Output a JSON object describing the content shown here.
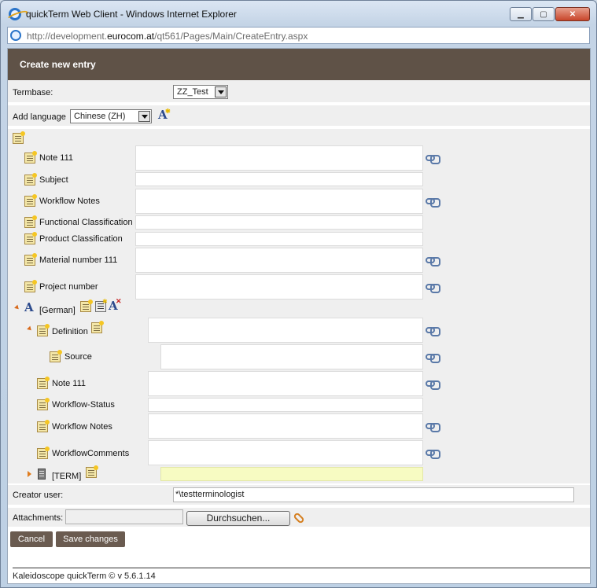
{
  "window": {
    "title": "quickTerm Web Client - Windows Internet Explorer",
    "url_prefix": "http://development.",
    "url_domain": "eurocom.at",
    "url_path": "/qt561/Pages/Main/CreateEntry.aspx",
    "buttons": {
      "minimize": "▁",
      "maximize": "▢",
      "close": "✕"
    }
  },
  "header": {
    "title": "Create new entry"
  },
  "termbase": {
    "label": "Termbase:",
    "value": "ZZ_Test"
  },
  "add_language": {
    "label": "Add language",
    "value": "Chinese (ZH)"
  },
  "entry_fields": [
    {
      "label": "Note 111"
    },
    {
      "label": "Subject"
    },
    {
      "label": "Workflow Notes"
    },
    {
      "label": "Functional Classification"
    },
    {
      "label": "Product Classification"
    },
    {
      "label": "Material number 111"
    },
    {
      "label": "Project number"
    }
  ],
  "language": {
    "label": "[German]"
  },
  "definition": {
    "label": "Definition"
  },
  "source": {
    "label": "Source"
  },
  "language_fields": [
    {
      "label": "Note 111"
    },
    {
      "label": "Workflow-Status"
    },
    {
      "label": "Workflow Notes"
    },
    {
      "label": "WorkflowComments"
    }
  ],
  "term": {
    "label": "[TERM]"
  },
  "creator": {
    "label": "Creator user:",
    "value": "*\\testterminologist"
  },
  "attachments": {
    "label": "Attachments:",
    "browse_label": "Durchsuchen..."
  },
  "actions": {
    "cancel": "Cancel",
    "save": "Save changes"
  },
  "footer": {
    "text": "Kaleidoscope quickTerm © v 5.6.1.14"
  }
}
